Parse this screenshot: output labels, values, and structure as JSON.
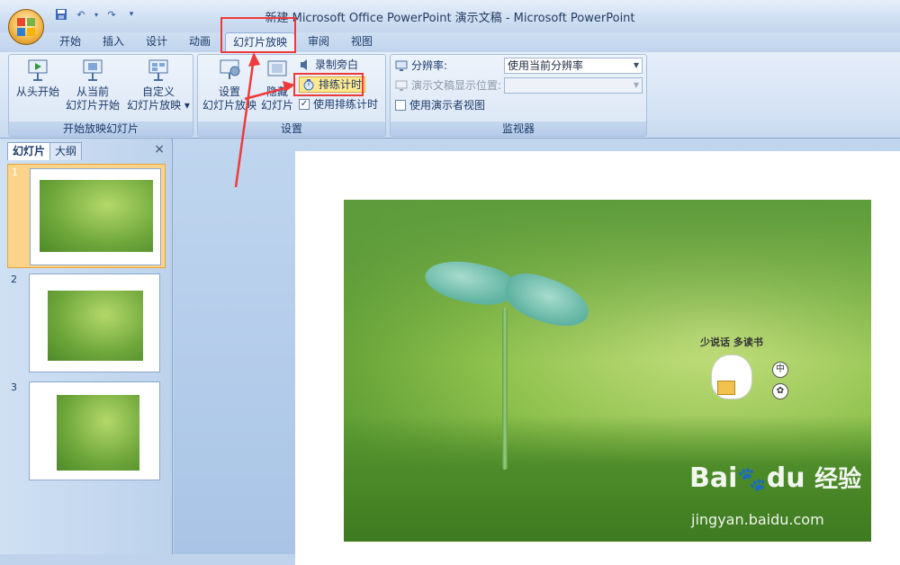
{
  "window": {
    "title": "新建 Microsoft Office PowerPoint 演示文稿 - Microsoft PowerPoint"
  },
  "quick_access": {
    "icons": [
      "save-icon",
      "undo-icon",
      "redo-icon",
      "customize-icon"
    ]
  },
  "tabs": [
    "开始",
    "插入",
    "设计",
    "动画",
    "幻灯片放映",
    "审阅",
    "视图"
  ],
  "active_tab": "幻灯片放映",
  "ribbon": {
    "start_group": {
      "label": "开始放映幻灯片",
      "from_start": "从头开始",
      "from_current_line1": "从当前",
      "from_current_line2": "幻灯片开始",
      "custom_line1": "自定义",
      "custom_line2": "幻灯片放映 ▾"
    },
    "setup_group": {
      "label": "设置",
      "setup_line1": "设置",
      "setup_line2": "幻灯片放映",
      "hide_line1": "隐藏",
      "hide_line2": "幻灯片",
      "record_narration": "录制旁白",
      "rehearse_timings": "排练计时",
      "use_rehearsed_timings": "使用排练计时",
      "use_rehearsed_checked": true
    },
    "monitors_group": {
      "label": "监视器",
      "resolution_label": "分辨率:",
      "resolution_value": "使用当前分辨率",
      "show_on_label": "演示文稿显示位置:",
      "show_on_value": "",
      "presenter_view": "使用演示者视图",
      "presenter_view_checked": false
    }
  },
  "slides_pane": {
    "tab_slides": "幻灯片",
    "tab_outline": "大纲",
    "close": "×",
    "slides": [
      {
        "number": "1",
        "selected": true
      },
      {
        "number": "2",
        "selected": false
      },
      {
        "number": "3",
        "selected": false
      }
    ]
  },
  "slide": {
    "caption": "少说话 多读书",
    "seal1": "中",
    "seal2": "✿"
  },
  "watermark": {
    "brand": "Bai",
    "brand2": "du",
    "brand3": "经验",
    "url": "jingyan.baidu.com"
  },
  "colors": {
    "highlight": "#ee3a3a",
    "selected_slide": "#fbd38a",
    "ribbon_bg": "#dae6f5"
  }
}
